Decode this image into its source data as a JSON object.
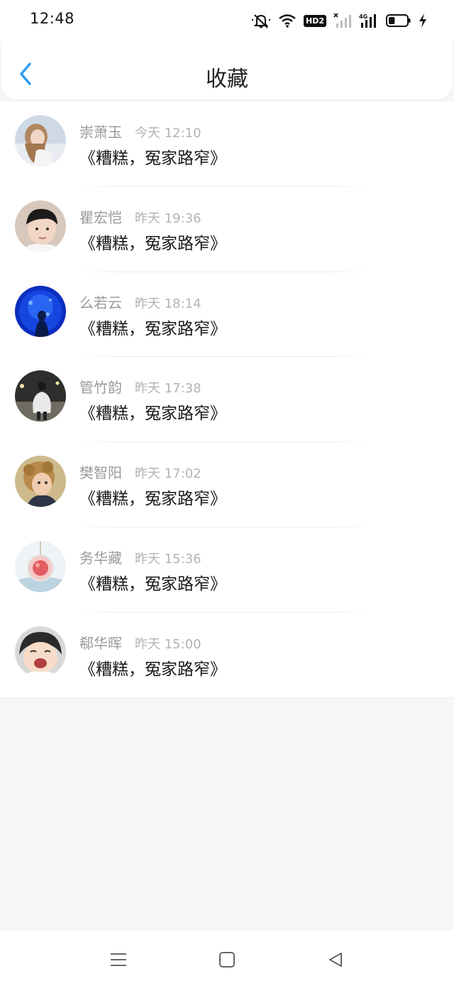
{
  "status_bar": {
    "time": "12:48",
    "icons": [
      "mute-bell-icon",
      "wifi-icon",
      "hd-icon",
      "signal-off-icon",
      "signal-4g-icon",
      "battery-icon",
      "charging-icon"
    ],
    "hd_label": "HD2",
    "network_label": "4G",
    "battery_level_percent": 35
  },
  "header": {
    "title": "收藏",
    "back_icon": "chevron-left-icon",
    "accent_color": "#2a9df4"
  },
  "favorites": [
    {
      "name": "崇萧玉",
      "time": "今天 12:10",
      "message": "《糟糕，冤家路窄》",
      "avatar": "girl-photo"
    },
    {
      "name": "瞿宏恺",
      "time": "昨天 19:36",
      "message": "《糟糕，冤家路窄》",
      "avatar": "boy-photo"
    },
    {
      "name": "么若云",
      "time": "昨天 18:14",
      "message": "《糟糕，冤家路窄》",
      "avatar": "aquarium-photo"
    },
    {
      "name": "管竹韵",
      "time": "昨天 17:38",
      "message": "《糟糕，冤家路窄》",
      "avatar": "night-street-photo"
    },
    {
      "name": "樊智阳",
      "time": "昨天 17:02",
      "message": "《糟糕，冤家路窄》",
      "avatar": "curly-child-photo"
    },
    {
      "name": "务华藏",
      "time": "昨天 15:36",
      "message": "《糟糕，冤家路窄》",
      "avatar": "pendant-photo"
    },
    {
      "name": "郗华晖",
      "time": "昨天 15:00",
      "message": "《糟糕，冤家路窄》",
      "avatar": "laughing-child-photo"
    }
  ],
  "nav_bar": {
    "buttons": [
      "menu-icon",
      "home-square-icon",
      "back-triangle-icon"
    ]
  }
}
